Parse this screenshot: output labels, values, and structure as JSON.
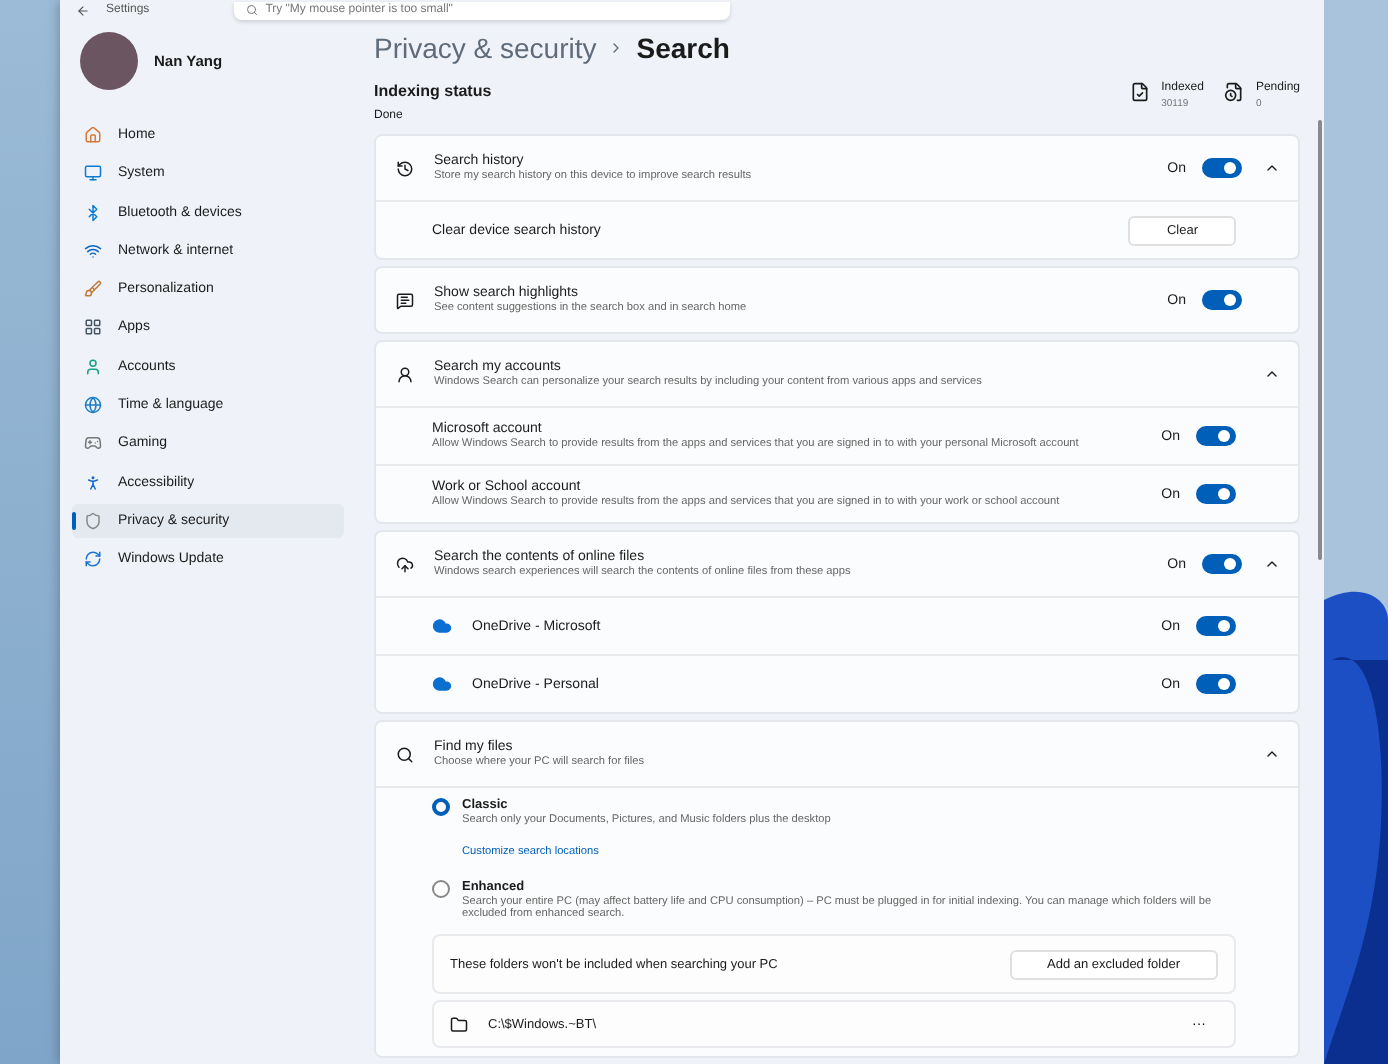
{
  "window": {
    "title": "Settings"
  },
  "search": {
    "placeholder": "Try \"My mouse pointer is too small\""
  },
  "user": {
    "name": "Nan Yang"
  },
  "sidebar": {
    "items": [
      {
        "label": "Home",
        "selected": false
      },
      {
        "label": "System",
        "selected": false
      },
      {
        "label": "Bluetooth & devices",
        "selected": false
      },
      {
        "label": "Network & internet",
        "selected": false
      },
      {
        "label": "Personalization",
        "selected": false
      },
      {
        "label": "Apps",
        "selected": false
      },
      {
        "label": "Accounts",
        "selected": false
      },
      {
        "label": "Time & language",
        "selected": false
      },
      {
        "label": "Gaming",
        "selected": false
      },
      {
        "label": "Accessibility",
        "selected": false
      },
      {
        "label": "Privacy & security",
        "selected": true
      },
      {
        "label": "Windows Update",
        "selected": false
      }
    ]
  },
  "breadcrumb": [
    "Privacy & security",
    "Search"
  ],
  "indexing": {
    "title": "Indexing status",
    "status": "Done",
    "stats": [
      {
        "label": "Indexed",
        "value": "30119"
      },
      {
        "label": "Pending",
        "value": "0"
      }
    ]
  },
  "cards": [
    {
      "title": "Search history",
      "description": "Store my search history on this device to improve search results",
      "toggle": {
        "on": true,
        "label": "On"
      },
      "expanded": true,
      "rows": [
        {
          "kind": "action",
          "label": "Clear device search history",
          "button": "Clear"
        }
      ]
    },
    {
      "title": "Show search highlights",
      "description": "See content suggestions in the search box and in search home",
      "toggle": {
        "on": true,
        "label": "On"
      }
    },
    {
      "title": "Search my accounts",
      "description": "Windows Search can personalize your search results by including your content from various apps and services",
      "expanded": true,
      "rows": [
        {
          "kind": "toggle",
          "label": "Microsoft account",
          "description": "Allow Windows Search to provide results from the apps and services that you are signed in to with your personal Microsoft account",
          "toggle": {
            "on": true,
            "label": "On"
          }
        },
        {
          "kind": "toggle",
          "label": "Work or School account",
          "description": "Allow Windows Search to provide results from the apps and services that you are signed in to with your work or school account",
          "toggle": {
            "on": true,
            "label": "On"
          }
        }
      ]
    },
    {
      "title": "Search the contents of online files",
      "description": "Windows search experiences will search the contents of online files from these apps",
      "toggle": {
        "on": true,
        "label": "On"
      },
      "expanded": true,
      "rows": [
        {
          "kind": "app",
          "label": "OneDrive - Microsoft",
          "toggle": {
            "on": true,
            "label": "On"
          }
        },
        {
          "kind": "app",
          "label": "OneDrive - Personal",
          "toggle": {
            "on": true,
            "label": "On"
          }
        }
      ]
    }
  ],
  "find_files": {
    "title": "Find my files",
    "description": "Choose where your PC will search for files",
    "expanded": true,
    "options": [
      {
        "label": "Classic",
        "description": "Search only your Documents, Pictures, and Music folders plus the desktop",
        "link": "Customize search locations",
        "selected": true
      },
      {
        "label": "Enhanced",
        "description": "Search your entire PC (may affect battery life and CPU consumption) – PC must be plugged in for initial indexing. You can manage which folders will be excluded from enhanced search.",
        "selected": false
      }
    ],
    "excluded": {
      "text": "These folders won't be included when searching your PC",
      "button": "Add an excluded folder"
    },
    "folders": [
      {
        "path": "C:\\$Windows.~BT\\",
        "menu": "···"
      }
    ]
  }
}
